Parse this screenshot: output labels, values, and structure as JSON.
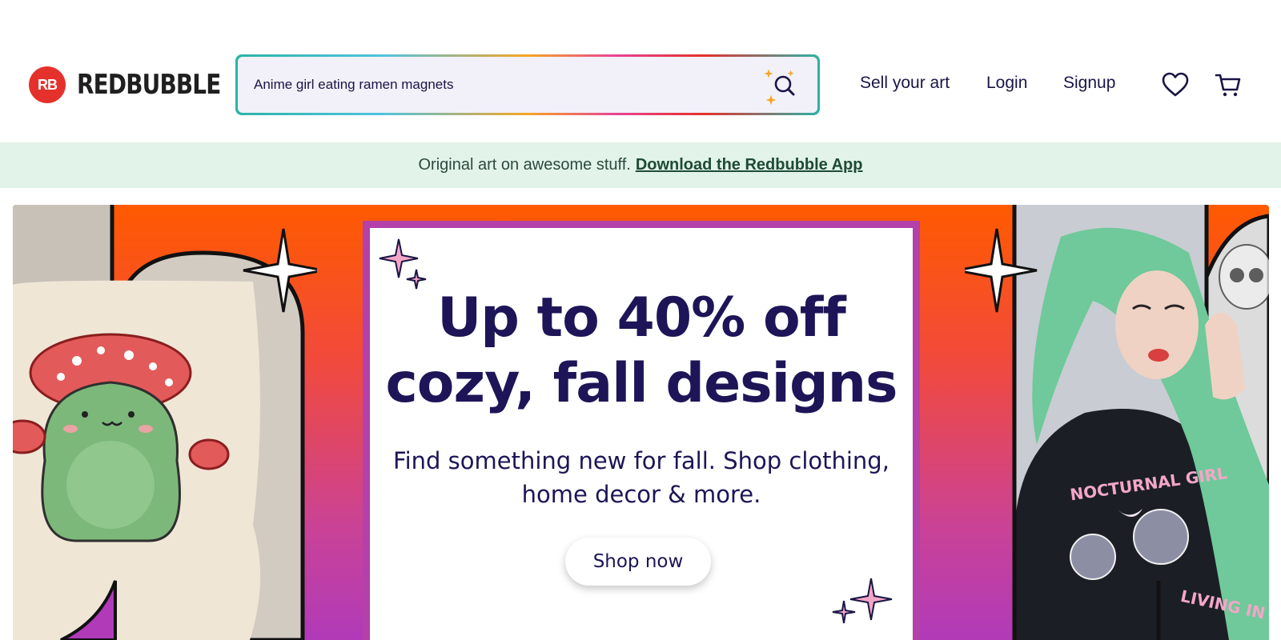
{
  "header": {
    "logo_mark": "RB",
    "logo_text": "REDBUBBLE",
    "search_value": "Anime girl eating ramen magnets",
    "nav": {
      "sell": "Sell your art",
      "login": "Login",
      "signup": "Signup"
    },
    "icons": [
      "search-icon",
      "heart-icon",
      "cart-icon"
    ]
  },
  "app_banner": {
    "text": "Original art on awesome stuff.",
    "link": "Download the Redbubble App"
  },
  "hero": {
    "headline": "Up to 40% off cozy, fall designs",
    "subline": "Find something new for fall. Shop clothing, home decor & more.",
    "cta": "Shop now",
    "shirt_text_1": "NOCTURNAL GIRL",
    "shirt_text_2": "LIVING IN A"
  },
  "colors": {
    "brand": "#e4312b",
    "navy": "#1d1557",
    "banner_bg": "#e2f3ea",
    "hero_top": "#ff5a00",
    "hero_bottom": "#b03ab8",
    "card_border": "#b341a9"
  }
}
